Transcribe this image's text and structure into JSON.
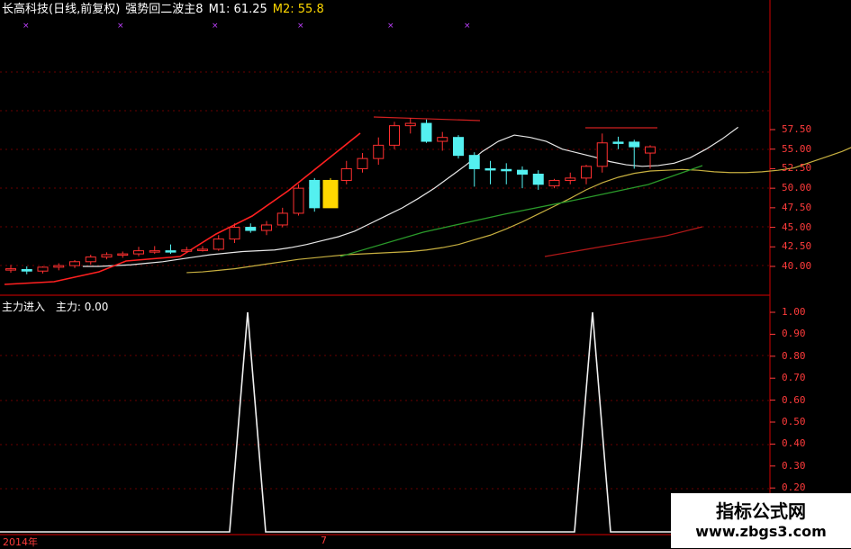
{
  "header": {
    "stock": "长高科技(日线,前复权)",
    "formula": "强势回二波主8",
    "m1_label": "M1: 61.25",
    "m2_label": "M2: 55.8",
    "colors": {
      "stock": "#ffffff",
      "formula": "#ffffff",
      "m1": "#ffffff",
      "m2": "#ffd800"
    }
  },
  "indicator": {
    "title": "主力进入",
    "value_label": "主力: 0.00"
  },
  "price_axis": [
    "57.50",
    "55.00",
    "52.50",
    "50.00",
    "47.50",
    "45.00",
    "42.50",
    "40.00"
  ],
  "indicator_axis": [
    "1.00",
    "0.90",
    "0.80",
    "0.70",
    "0.60",
    "0.50",
    "0.40",
    "0.30",
    "0.20"
  ],
  "date_axis": {
    "start": "2014年",
    "mid": "7"
  },
  "watermark": {
    "line1": "指标公式网",
    "line2": "www.zbgs3.com"
  },
  "chart_data": {
    "type": "candlestick",
    "price_ylim": [
      38.5,
      58.5
    ],
    "indicator_ylim": [
      0,
      1.0
    ],
    "candles": [
      {
        "o": 39.6,
        "h": 40.2,
        "l": 39.2,
        "c": 39.7,
        "up": true
      },
      {
        "o": 39.6,
        "h": 40.0,
        "l": 39.0,
        "c": 39.4,
        "up": false
      },
      {
        "o": 39.4,
        "h": 40.0,
        "l": 39.1,
        "c": 39.9,
        "up": true
      },
      {
        "o": 39.9,
        "h": 40.4,
        "l": 39.5,
        "c": 40.1,
        "up": true
      },
      {
        "o": 40.1,
        "h": 40.8,
        "l": 39.8,
        "c": 40.6,
        "up": true
      },
      {
        "o": 40.6,
        "h": 41.5,
        "l": 40.2,
        "c": 41.2,
        "up": true
      },
      {
        "o": 41.2,
        "h": 41.8,
        "l": 40.9,
        "c": 41.5,
        "up": true
      },
      {
        "o": 41.5,
        "h": 41.9,
        "l": 41.1,
        "c": 41.6,
        "up": true
      },
      {
        "o": 41.6,
        "h": 42.5,
        "l": 41.3,
        "c": 42.0,
        "up": true
      },
      {
        "o": 42.0,
        "h": 42.6,
        "l": 41.6,
        "c": 41.9,
        "up": true
      },
      {
        "o": 41.9,
        "h": 42.8,
        "l": 41.6,
        "c": 42.0,
        "up": false
      },
      {
        "o": 42.0,
        "h": 42.5,
        "l": 41.8,
        "c": 42.1,
        "up": true
      },
      {
        "o": 42.1,
        "h": 42.6,
        "l": 41.9,
        "c": 42.2,
        "up": true
      },
      {
        "o": 42.2,
        "h": 44.0,
        "l": 42.0,
        "c": 43.5,
        "up": true
      },
      {
        "o": 43.5,
        "h": 45.5,
        "l": 43.0,
        "c": 45.0,
        "up": true
      },
      {
        "o": 45.0,
        "h": 45.5,
        "l": 44.3,
        "c": 44.6,
        "up": false
      },
      {
        "o": 44.6,
        "h": 45.8,
        "l": 44.0,
        "c": 45.3,
        "up": true
      },
      {
        "o": 45.3,
        "h": 47.5,
        "l": 45.0,
        "c": 46.8,
        "up": true
      },
      {
        "o": 46.8,
        "h": 50.5,
        "l": 46.5,
        "c": 50.0,
        "up": true
      },
      {
        "o": 51.0,
        "h": 51.3,
        "l": 47.0,
        "c": 47.5,
        "up": false
      },
      {
        "o": 47.5,
        "h": 51.3,
        "l": 47.5,
        "c": 51.0,
        "up": true,
        "highlight": true
      },
      {
        "o": 51.0,
        "h": 53.5,
        "l": 50.5,
        "c": 52.5,
        "up": true
      },
      {
        "o": 52.5,
        "h": 54.5,
        "l": 52.0,
        "c": 53.8,
        "up": true
      },
      {
        "o": 53.8,
        "h": 56.5,
        "l": 53.0,
        "c": 55.5,
        "up": true
      },
      {
        "o": 55.5,
        "h": 58.5,
        "l": 55.0,
        "c": 58.0,
        "up": true
      },
      {
        "o": 58.0,
        "h": 59.0,
        "l": 57.0,
        "c": 58.3,
        "up": true
      },
      {
        "o": 58.3,
        "h": 58.8,
        "l": 55.8,
        "c": 56.0,
        "up": false
      },
      {
        "o": 56.0,
        "h": 57.2,
        "l": 54.8,
        "c": 56.5,
        "up": true
      },
      {
        "o": 56.5,
        "h": 56.8,
        "l": 53.8,
        "c": 54.2,
        "up": false
      },
      {
        "o": 54.2,
        "h": 54.6,
        "l": 50.2,
        "c": 52.5,
        "up": false
      },
      {
        "o": 52.5,
        "h": 53.5,
        "l": 50.5,
        "c": 52.4,
        "up": false
      },
      {
        "o": 52.4,
        "h": 53.2,
        "l": 50.5,
        "c": 52.3,
        "up": false
      },
      {
        "o": 52.3,
        "h": 52.8,
        "l": 50.0,
        "c": 51.8,
        "up": false
      },
      {
        "o": 51.8,
        "h": 52.3,
        "l": 49.8,
        "c": 50.5,
        "up": false
      },
      {
        "o": 50.3,
        "h": 51.2,
        "l": 50.0,
        "c": 51.0,
        "up": true
      },
      {
        "o": 51.0,
        "h": 52.0,
        "l": 50.5,
        "c": 51.3,
        "up": true
      },
      {
        "o": 51.3,
        "h": 53.0,
        "l": 50.5,
        "c": 52.8,
        "up": true
      },
      {
        "o": 52.8,
        "h": 57.0,
        "l": 52.0,
        "c": 55.8,
        "up": true
      },
      {
        "o": 55.8,
        "h": 56.6,
        "l": 55.0,
        "c": 55.9,
        "up": false
      },
      {
        "o": 55.9,
        "h": 56.2,
        "l": 52.5,
        "c": 55.3,
        "up": false
      },
      {
        "o": 55.3,
        "h": 55.5,
        "l": 52.5,
        "c": 54.5,
        "up": true
      }
    ],
    "ma_white": [
      40.0,
      40.0,
      40.1,
      40.2,
      40.4,
      40.6,
      40.9,
      41.2,
      41.5,
      41.7,
      41.9,
      42.0,
      42.1,
      42.4,
      42.8,
      43.3,
      43.8,
      44.5,
      45.5,
      46.5,
      47.5,
      48.7,
      50.0,
      51.5,
      53.0,
      54.7,
      56.0,
      56.8,
      56.5,
      56.0,
      55.0,
      54.5,
      54.0,
      53.4,
      53.0,
      52.8,
      52.9,
      53.2,
      53.9,
      55.0,
      56.3,
      57.8
    ],
    "ma_yellow": [
      39.2,
      39.3,
      39.5,
      39.7,
      40.0,
      40.3,
      40.6,
      40.9,
      41.1,
      41.3,
      41.5,
      41.6,
      41.7,
      41.8,
      41.9,
      42.1,
      42.4,
      42.8,
      43.4,
      44.0,
      44.8,
      45.7,
      46.7,
      47.7,
      48.7,
      49.8,
      50.7,
      51.4,
      51.9,
      52.2,
      52.3,
      52.4,
      52.3,
      52.1,
      52.0,
      52.0,
      52.1,
      52.3,
      52.6,
      53.3,
      54.0,
      54.7,
      55.6
    ],
    "ma_green": [],
    "ma_red": [],
    "signal_peaks_x": [
      275,
      658
    ]
  }
}
